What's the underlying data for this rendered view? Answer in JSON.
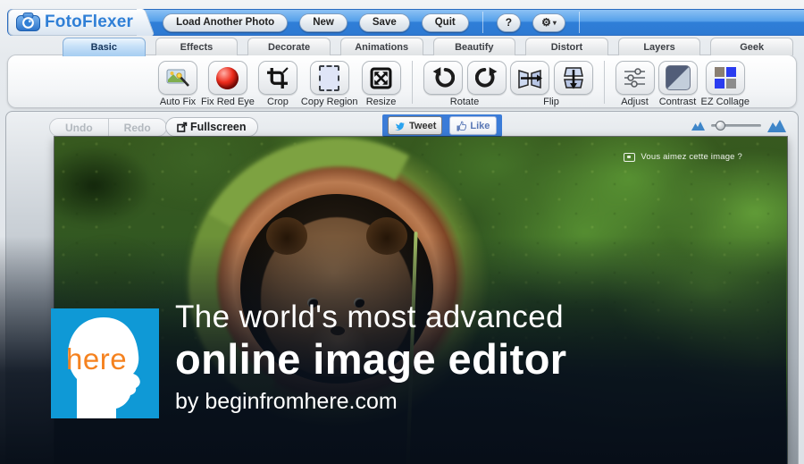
{
  "topbar": {
    "brand": "FotoFlexer",
    "load": "Load Another Photo",
    "new": "New",
    "save": "Save",
    "quit": "Quit",
    "help": "?"
  },
  "icons": {
    "gear": "⚙",
    "caret": "▾"
  },
  "tabs": [
    {
      "label": "Basic",
      "active": true
    },
    {
      "label": "Effects",
      "active": false
    },
    {
      "label": "Decorate",
      "active": false
    },
    {
      "label": "Animations",
      "active": false
    },
    {
      "label": "Beautify",
      "active": false
    },
    {
      "label": "Distort",
      "active": false
    },
    {
      "label": "Layers",
      "active": false
    },
    {
      "label": "Geek",
      "active": false
    }
  ],
  "toolbar": {
    "auto_fix": "Auto Fix",
    "fix_red_eye": "Fix Red Eye",
    "crop": "Crop",
    "copy_region": "Copy Region",
    "resize": "Resize",
    "rotate": "Rotate",
    "flip": "Flip",
    "adjust": "Adjust",
    "contrast": "Contrast",
    "ez_collage": "EZ Collage"
  },
  "workspace": {
    "undo": "Undo",
    "redo": "Redo",
    "fullscreen": "Fullscreen"
  },
  "social": {
    "tweet": "Tweet",
    "like": "Like"
  },
  "photo": {
    "prompt": "Vous aimez cette image ?"
  },
  "promo": {
    "logo": "here",
    "line1": "The world's most advanced",
    "line2": "online image editor",
    "line3": "by beginfromhere.com"
  },
  "colors": {
    "topbar-blue": "#3a86de",
    "here-blue": "#0f99d6",
    "here-orange": "#f5821f",
    "social-strip-blue": "#3b7cd8",
    "twitter-blue": "#2aa3ef",
    "like-blue": "#5877b5"
  }
}
